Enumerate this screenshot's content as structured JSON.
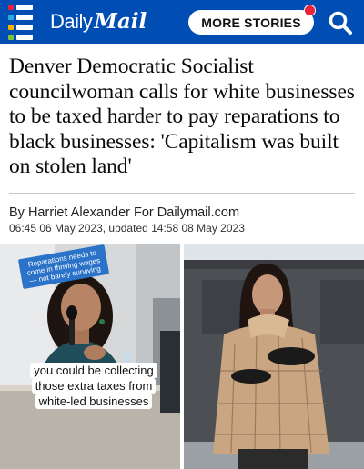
{
  "header": {
    "logo_daily": "Daily",
    "logo_mail": "Mail",
    "more_stories_label": "MORE STORIES",
    "menu_colors": [
      "#e8233a",
      "#2eaadc",
      "#f7b500",
      "#7cc242"
    ],
    "background": "#004db3",
    "notification_color": "#e8233a"
  },
  "article": {
    "headline": "Denver Democratic Socialist councilwoman calls for white businesses to be taxed harder to pay reparations to black businesses: 'Capitalism was built on stolen land'",
    "byline": "By Harriet Alexander For Dailymail.com",
    "dateline": "06:45 06 May 2023, updated 14:58 08 May 2023"
  },
  "photos": {
    "left_sticker": "Reparations needs to come in thriving wages — not barely surviving",
    "left_caption": "you could be collecting those extra taxes from white-led businesses"
  }
}
